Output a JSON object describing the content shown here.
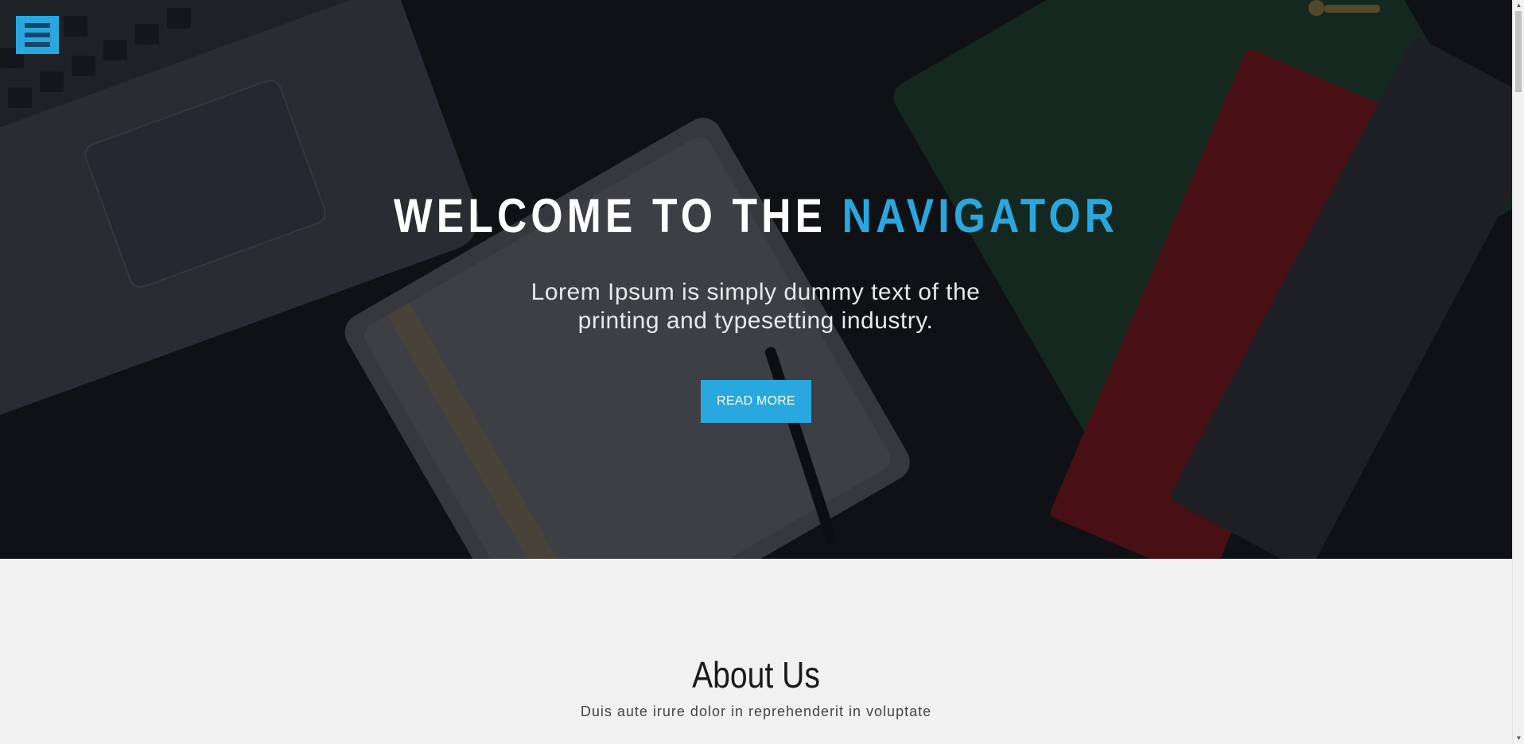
{
  "menu": {
    "icon": "hamburger-icon"
  },
  "hero": {
    "title_prefix": "WELCOME TO THE ",
    "title_accent": "NAVIGATOR",
    "subtitle_line1": "Lorem Ipsum is simply dummy text of the",
    "subtitle_line2": "printing and typesetting industry.",
    "button_label": "READ MORE"
  },
  "about": {
    "title": "About Us",
    "subtitle": "Duis aute irure dolor in reprehenderit in voluptate"
  },
  "scrollbar": {
    "up_icon": "▲",
    "down_icon": "▼"
  },
  "colors": {
    "accent": "#29a8e0",
    "hero_bg": "#141619",
    "section_bg": "#f1f1f1"
  }
}
